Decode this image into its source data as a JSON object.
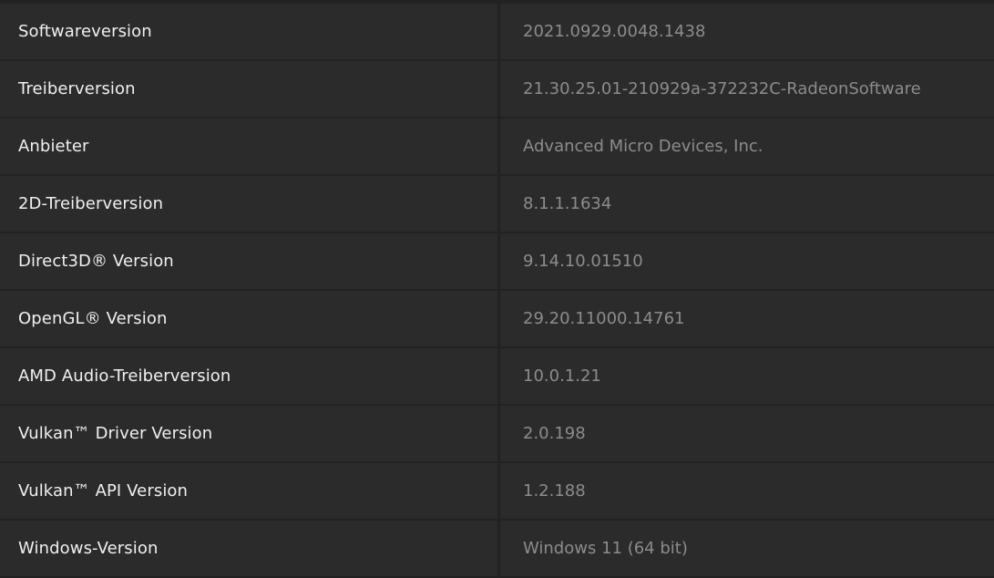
{
  "system_info": {
    "rows": [
      {
        "label": "Softwareversion",
        "value": "2021.0929.0048.1438"
      },
      {
        "label": "Treiberversion",
        "value": "21.30.25.01-210929a-372232C-RadeonSoftware"
      },
      {
        "label": "Anbieter",
        "value": "Advanced Micro Devices, Inc."
      },
      {
        "label": "2D-Treiberversion",
        "value": "8.1.1.1634"
      },
      {
        "label": "Direct3D® Version",
        "value": "9.14.10.01510"
      },
      {
        "label": "OpenGL® Version",
        "value": "29.20.11000.14761"
      },
      {
        "label": "AMD Audio-Treiberversion",
        "value": "10.0.1.21"
      },
      {
        "label": "Vulkan™ Driver Version",
        "value": "2.0.198"
      },
      {
        "label": "Vulkan™ API Version",
        "value": "1.2.188"
      },
      {
        "label": "Windows-Version",
        "value": "Windows 11 (64 bit)"
      }
    ]
  },
  "colors": {
    "background": "#222222",
    "cell": "#2b2b2b",
    "label_text": "#f0f0f0",
    "value_text": "#8c8c8c"
  }
}
